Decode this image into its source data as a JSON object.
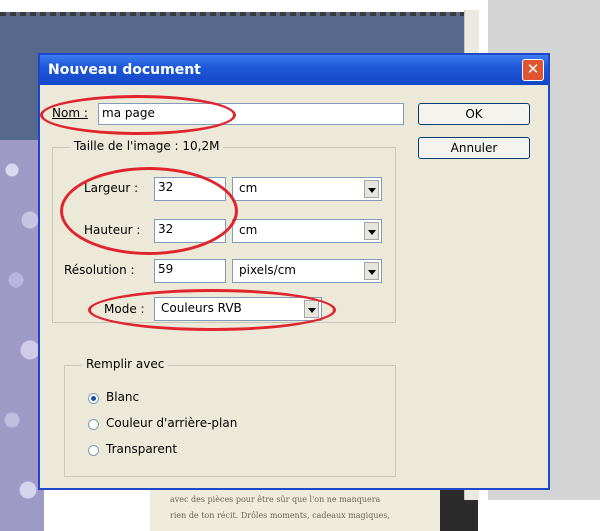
{
  "dialog": {
    "title": "Nouveau document",
    "close_icon": "close-icon"
  },
  "name": {
    "label": "Nom :",
    "value": "ma page"
  },
  "image_size": {
    "title": "Taille de l'image : 10,2M",
    "width": {
      "label": "Largeur :",
      "value": "32",
      "unit": "cm"
    },
    "height": {
      "label": "Hauteur :",
      "value": "32",
      "unit": "cm"
    },
    "resolution": {
      "label": "Résolution :",
      "value": "59",
      "unit": "pixels/cm"
    },
    "mode": {
      "label": "Mode :",
      "value": "Couleurs RVB"
    }
  },
  "buttons": {
    "ok": "OK",
    "cancel": "Annuler"
  },
  "fill": {
    "title": "Remplir avec",
    "options": [
      {
        "label": "Blanc",
        "checked": true
      },
      {
        "label": "Couleur d'arrière-plan",
        "checked": false
      },
      {
        "label": "Transparent",
        "checked": false
      }
    ]
  },
  "background_text": {
    "line1": "avec des pièces pour être sûr que l'on ne manquera",
    "line2": "rien de ton récit. Drôles moments, cadeaux magiques,"
  },
  "colors": {
    "titlebar": "#1e58d8",
    "dialog": "#ece9d8",
    "highlight_ring": "#e0242d"
  }
}
